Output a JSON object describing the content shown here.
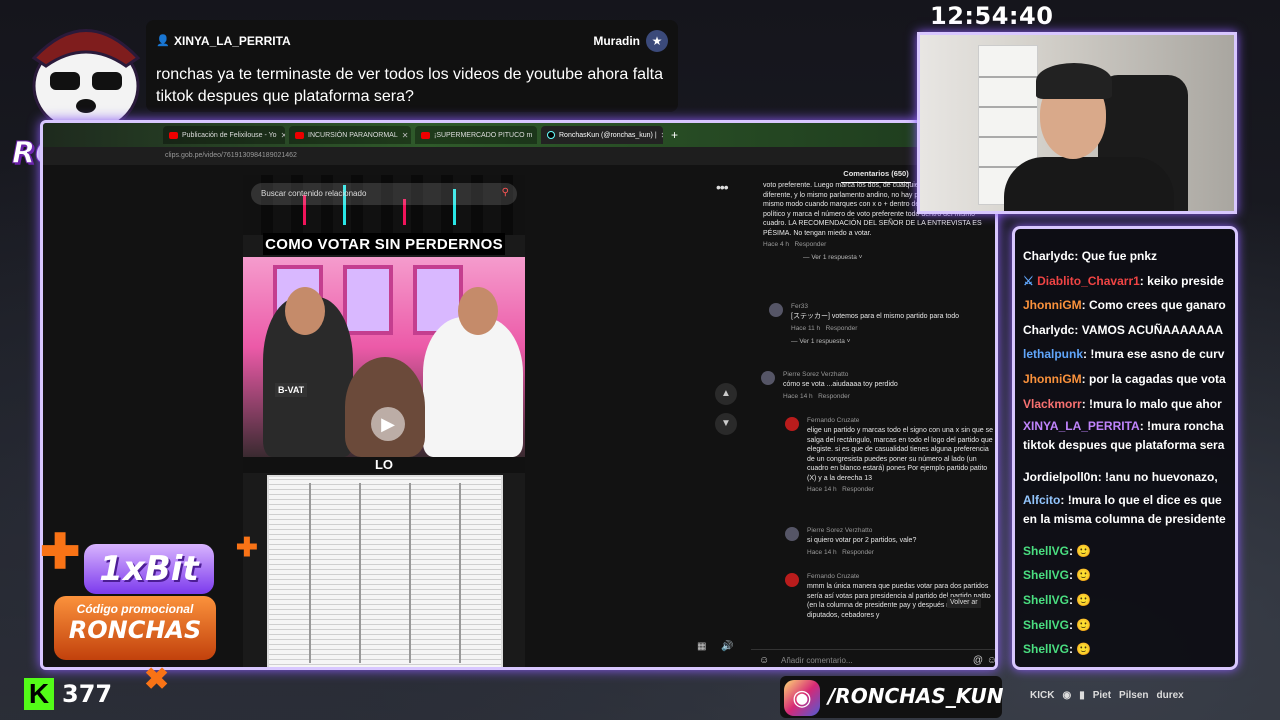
{
  "overlay": {
    "brand_name": "RONCHAS",
    "clock": "12:54:40",
    "highlight": {
      "username": "XINYA_LA_PERRITA",
      "channel": "Muradin",
      "message": "ronchas ya te terminaste de ver todos los videos de youtube ahora falta tiktok despues que plataforma sera?"
    }
  },
  "browser": {
    "tabs": [
      {
        "label": "Publicación de Felixilouse - Yo",
        "icon": "youtube-icon",
        "active": false
      },
      {
        "label": "INCURSIÓN PARANORMAL",
        "icon": "youtube-icon",
        "active": false
      },
      {
        "label": "¡SUPERMERCADO PITUCO m",
        "icon": "youtube-icon",
        "active": false
      },
      {
        "label": "RonchasKun (@ronchas_kun) |",
        "icon": "tiktok-icon",
        "active": true
      }
    ],
    "url": "clips.gob.pe/video/7619130984189021462"
  },
  "video": {
    "search_placeholder": "Buscar contenido relacionado",
    "title": "COMO VOTAR SIN PERDERNOS",
    "caption": "LO",
    "scene_labels": [
      "B-VAT"
    ]
  },
  "comments": {
    "header": "Comentarios (650)",
    "input_placeholder": "Añadir comentario...",
    "back_label": "Volver ar",
    "items": [
      {
        "author": "",
        "text": "voto preferente. Luego marca los dos, de cualquier forma, marca igual o diferente, y lo mismo parlamento andino, no hay problema de marcar del mismo modo cuando marques con x o + dentro del recuadro del partido político y marca el número de voto preferente todo dentro del mismo cuadro. LA RECOMENDACIÓN DEL SEÑOR DE LA ENTREVISTA ES PÉSIMA. No tengan miedo a votar.",
        "time": "Hace 4 h",
        "reply": "Responder",
        "replies": "Ver 1 respuesta"
      },
      {
        "author": "Fer33",
        "text": "[ステッカー] votemos para el mismo partido para todo",
        "time": "Hace 11 h",
        "reply": "Responder",
        "replies": "Ver 1 respuesta"
      },
      {
        "author": "Pierre Sorez Verzhatto",
        "text": "cómo se vota ...aiudaaaa toy perdido",
        "time": "Hace 14 h",
        "reply": "Responder"
      },
      {
        "author": "Fernando Cruzate",
        "text": "elige un partido y marcas todo el signo con una x sin que se salga del rectángulo, marcas en todo el logo del partido que elegiste. si es que de casualidad tienes alguna preferencia de un congresista puedes poner su número al lado (un cuadro en blanco estará) pones Por ejemplo partido patito (X) y a la derecha 13",
        "time": "Hace 14 h",
        "reply": "Responder"
      },
      {
        "author": "Pierre Sorez Verzhatto",
        "text": "si quiero votar por 2 partidos, vale?",
        "time": "Hace 14 h",
        "reply": "Responder"
      },
      {
        "author": "Fernando Cruzate",
        "text": "mmm la única manera que puedas votar para dos partidos sería así votas para presidencia al partido del partido patito (en la columna de presidente pay y después marcas en diputados, cebadores y"
      }
    ]
  },
  "chat": {
    "lines": [
      {
        "user": "Charlydc",
        "color": "#ffffff",
        "msg": "Que fue pnkz"
      },
      {
        "user": "Diablito_Chavarr1",
        "color": "#ef4444",
        "msg": "keiko preside",
        "badge": "sword-icon"
      },
      {
        "user": "JhonniGM",
        "color": "#fb923c",
        "msg": "Como crees que ganaro"
      },
      {
        "user": "Charlydc",
        "color": "#ffffff",
        "msg": "VAMOS ACUÑAAAAAAA"
      },
      {
        "user": "lethalpunk",
        "color": "#60a5fa",
        "msg": "!mura ese asno de curv"
      },
      {
        "user": "JhonniGM",
        "color": "#fb923c",
        "msg": "por la cagadas que vota"
      },
      {
        "user": "Vlackmorr",
        "color": "#f87171",
        "msg": "!mura lo malo que ahor"
      },
      {
        "user": "XINYA_LA_PERRITA",
        "color": "#c084fc",
        "msg": "!mura roncha tiktok despues que plataforma sera"
      },
      {
        "user": "Jordielpoll0n",
        "color": "#ffffff",
        "msg": "!anu no huevonazo,"
      },
      {
        "user": "Alfcito",
        "color": "#93c5fd",
        "msg": "!mura lo que el dice es que en la misma columna de presidente"
      },
      {
        "user": "ShellVG",
        "color": "#4ade80",
        "msg": "🙂"
      },
      {
        "user": "ShellVG",
        "color": "#4ade80",
        "msg": "🙂"
      },
      {
        "user": "ShellVG",
        "color": "#4ade80",
        "msg": "🙂"
      },
      {
        "user": "ShellVG",
        "color": "#4ade80",
        "msg": "🙂"
      },
      {
        "user": "ShellVG",
        "color": "#4ade80",
        "msg": "🙂"
      }
    ]
  },
  "sponsor": {
    "brand": "1xBit",
    "promo_label": "Código promocional",
    "promo_code": "RONCHAS"
  },
  "kick": {
    "viewers": "377"
  },
  "instagram": {
    "handle": "/RONCHAS_KUN"
  },
  "sponsors_row": [
    "KICK",
    "Piet",
    "Pilsen",
    "durex"
  ],
  "colors": {
    "frame": "#d8c7ff",
    "glow": "#8b5cf6",
    "kick_green": "#53fc18"
  }
}
